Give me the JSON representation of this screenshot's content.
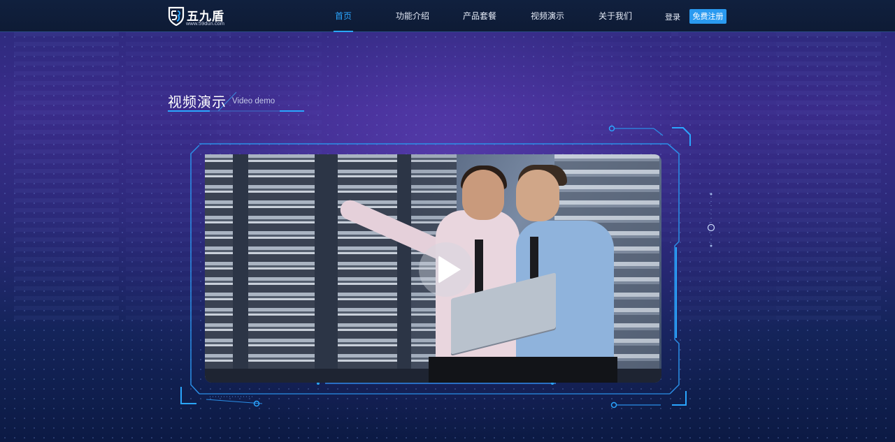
{
  "header": {
    "logo_text": "五九盾",
    "logo_url": "www.59dun.com",
    "nav": [
      {
        "label": "首页",
        "active": true
      },
      {
        "label": "功能介绍",
        "active": false
      },
      {
        "label": "产品套餐",
        "active": false
      },
      {
        "label": "视频演示",
        "active": false
      },
      {
        "label": "关于我们",
        "active": false
      }
    ],
    "login_label": "登录",
    "register_label": "免费注册"
  },
  "section": {
    "title": "视频演示",
    "subtitle": "Video demo"
  },
  "video": {
    "play_icon": "play-icon"
  },
  "colors": {
    "accent": "#2aa6ff",
    "register_bg": "#2a9af0",
    "nav_bg": "#0e1b35",
    "frame_line": "#2a8fe8"
  }
}
